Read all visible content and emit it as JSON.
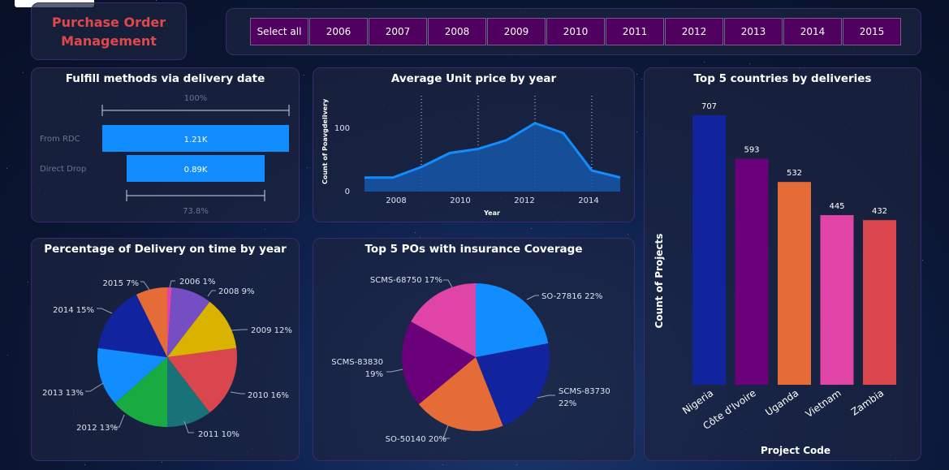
{
  "app_title_line1": "Purchase Order",
  "app_title_line2": "Management",
  "slicer": {
    "items": [
      "Select all",
      "2006",
      "2007",
      "2008",
      "2009",
      "2010",
      "2011",
      "2012",
      "2013",
      "2014",
      "2015"
    ],
    "button_color": "#50005f"
  },
  "colors": {
    "accent_blue": "#118dff",
    "title_red": "#e0484e",
    "navy": "#12239e",
    "purple": "#6b007b",
    "orange": "#e66c37",
    "pink": "#e044a7",
    "red": "#d9464e",
    "yellow": "#d9b300",
    "violet": "#744ec2",
    "teal": "#197278",
    "green": "#1aab40"
  },
  "funnel": {
    "title": "Fulfill methods via delivery date",
    "top_pct": "100%",
    "bottom_pct": "73.8%",
    "rows": [
      {
        "category": "From RDC",
        "label": "1.21K",
        "value": 1210
      },
      {
        "category": "Direct Drop",
        "label": "0.89K",
        "value": 890
      }
    ]
  },
  "line_chart": {
    "title": "Average Unit price by year",
    "ylabel": "Count of Poavgdelivery",
    "xlabel": "Year",
    "xticks": [
      "2008",
      "2010",
      "2012",
      "2014"
    ],
    "yticks": [
      "0",
      "100"
    ]
  },
  "country_chart": {
    "title": "Top 5 countries by deliveries",
    "ylabel": "Count of Projects",
    "xlabel": "Project Code"
  },
  "pie_year": {
    "title": "Percentage of Delivery on time by year",
    "labels": [
      "2006 1%",
      "2008 9%",
      "2009 12%",
      "2010 16%",
      "2011 10%",
      "2012 13%",
      "2013 13%",
      "2014 15%",
      "2015 7%"
    ]
  },
  "pie_po": {
    "title": "Top 5 POs with insurance Coverage",
    "labels": [
      "SO-27816 22%",
      "SCMS-83730",
      "22%",
      "SO-50140 20%",
      "SCMS-83830",
      "19%",
      "SCMS-68750 17%"
    ]
  },
  "chart_data": [
    {
      "type": "line",
      "title": "Average Unit price by year",
      "xlabel": "Year",
      "ylabel": "Count of Poavgdelivery",
      "x": [
        2006,
        2007,
        2008,
        2009,
        2010,
        2011,
        2012,
        2013,
        2014,
        2015
      ],
      "series": [
        {
          "values": [
            24,
            24,
            42,
            66,
            73,
            88,
            117,
            100,
            36,
            24
          ]
        }
      ],
      "ylim": [
        0,
        150
      ],
      "xlim": [
        2006,
        2015
      ]
    },
    {
      "type": "bar",
      "title": "Top 5 countries by deliveries",
      "xlabel": "Project Code",
      "ylabel": "Count of Projects",
      "categories": [
        "Nigeria",
        "Côte d'Ivoire",
        "Uganda",
        "Vietnam",
        "Zambia"
      ],
      "values": [
        707,
        593,
        532,
        445,
        432
      ],
      "value_labels": [
        "707",
        "593",
        "532",
        "445",
        "432"
      ],
      "colors": [
        "#12239e",
        "#6b007b",
        "#e66c37",
        "#e044a7",
        "#d9464e"
      ],
      "ylim": [
        0,
        707
      ]
    },
    {
      "type": "pie",
      "title": "Percentage of Delivery on time by year",
      "categories": [
        "2006",
        "2008",
        "2009",
        "2010",
        "2011",
        "2012",
        "2013",
        "2014",
        "2015"
      ],
      "values": [
        1,
        9,
        12,
        16,
        10,
        13,
        13,
        15,
        7
      ],
      "colors": [
        "#e044a7",
        "#744ec2",
        "#d9b300",
        "#d9464e",
        "#197278",
        "#1aab40",
        "#118dff",
        "#12239e",
        "#e66c37"
      ]
    },
    {
      "type": "pie",
      "title": "Top 5 POs with insurance Coverage",
      "categories": [
        "SO-27816",
        "SCMS-83730",
        "SO-50140",
        "SCMS-83830",
        "SCMS-68750"
      ],
      "values": [
        22,
        22,
        20,
        19,
        17
      ],
      "colors": [
        "#118dff",
        "#12239e",
        "#e66c37",
        "#6b007b",
        "#e044a7"
      ]
    }
  ]
}
